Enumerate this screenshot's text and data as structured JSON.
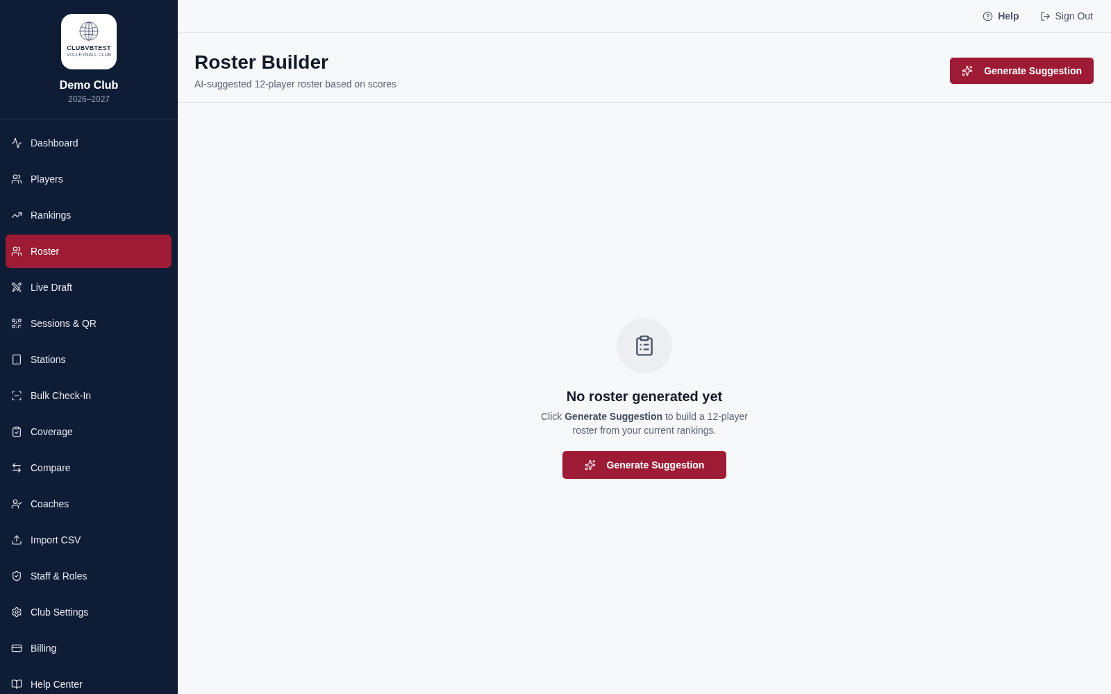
{
  "sidebar": {
    "logo": {
      "wordmark": "CLUBVBTEST",
      "tagline": "VOLLEYBALL CLUB"
    },
    "club_name": "Demo Club",
    "season": "2026–2027",
    "items": [
      {
        "label": "Dashboard",
        "selected": false
      },
      {
        "label": "Players",
        "selected": false
      },
      {
        "label": "Rankings",
        "selected": false
      },
      {
        "label": "Roster",
        "selected": true
      },
      {
        "label": "Live Draft",
        "selected": false
      },
      {
        "label": "Sessions & QR",
        "selected": false
      },
      {
        "label": "Stations",
        "selected": false
      },
      {
        "label": "Bulk Check-In",
        "selected": false
      },
      {
        "label": "Coverage",
        "selected": false
      },
      {
        "label": "Compare",
        "selected": false
      },
      {
        "label": "Coaches",
        "selected": false
      },
      {
        "label": "Import CSV",
        "selected": false
      },
      {
        "label": "Staff & Roles",
        "selected": false
      },
      {
        "label": "Club Settings",
        "selected": false
      },
      {
        "label": "Billing",
        "selected": false
      },
      {
        "label": "Help Center",
        "selected": false
      }
    ]
  },
  "top_bar": {
    "links": [
      {
        "label": "Help",
        "kind": "help"
      },
      {
        "label": "Sign Out",
        "kind": "signout"
      }
    ]
  },
  "header": {
    "title": "Roster Builder",
    "subtitle": "AI-suggested 12-player roster based on scores",
    "button": "Generate Suggestion"
  },
  "empty_state": {
    "title": "No roster generated yet",
    "description": "Click **Generate Suggestion** to build a 12-player roster from your current rankings.",
    "button": "Generate Suggestion"
  }
}
